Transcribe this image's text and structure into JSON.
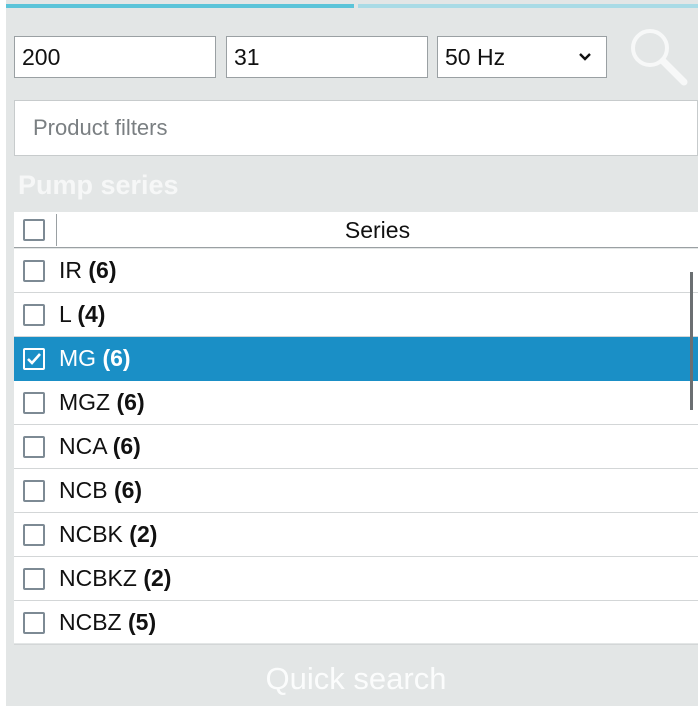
{
  "search": {
    "field1_value": "200",
    "field2_value": "31",
    "frequency_value": "50 Hz",
    "filters_placeholder": "Product filters"
  },
  "section_title": "Pump series",
  "table": {
    "header": "Series",
    "rows": [
      {
        "name": "IR",
        "count": "(6)",
        "checked": false
      },
      {
        "name": "L",
        "count": "(4)",
        "checked": false
      },
      {
        "name": "MG",
        "count": "(6)",
        "checked": true
      },
      {
        "name": "MGZ",
        "count": "(6)",
        "checked": false
      },
      {
        "name": "NCA",
        "count": "(6)",
        "checked": false
      },
      {
        "name": "NCB",
        "count": "(6)",
        "checked": false
      },
      {
        "name": "NCBK",
        "count": "(2)",
        "checked": false
      },
      {
        "name": "NCBKZ",
        "count": "(2)",
        "checked": false
      },
      {
        "name": "NCBZ",
        "count": "(5)",
        "checked": false
      }
    ]
  },
  "footer": {
    "quick_search_label": "Quick search"
  },
  "colors": {
    "accent": "#1a8fc6",
    "panel_bg": "#e3e6e6",
    "tab_accent": "#5bc4d9"
  },
  "icons": {
    "search": "magnifier-icon",
    "dropdown": "chevron-down-icon",
    "check": "checkmark-icon"
  }
}
